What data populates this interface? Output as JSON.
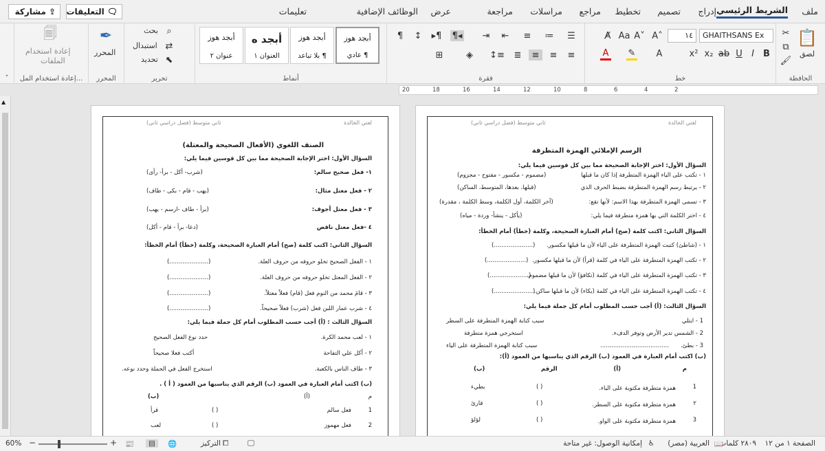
{
  "tabs": {
    "file": "ملف",
    "home": "الشريط الرئيسي",
    "insert": "إدراج",
    "design": "تصميم",
    "layout": "تخطيط",
    "references": "مراجع",
    "mailings": "مراسلات",
    "review": "مراجعة",
    "view": "عرض",
    "addins": "الوظائف الإضافية",
    "help": "تعليمات"
  },
  "topbar": {
    "comments": "التعليقات",
    "share": "مشاركة"
  },
  "clipboard": {
    "paste": "لصق",
    "label": "الحافظة"
  },
  "font": {
    "name": "GHAITHSANS Ex",
    "size": "١٤",
    "label": "خط"
  },
  "paragraph": {
    "label": "فقرة"
  },
  "styles": {
    "label": "أنماط",
    "items": [
      {
        "sample": "أبجد هوز",
        "name": "¶ عادي"
      },
      {
        "sample": "أبجد هوز",
        "name": "¶ بلا تباعد"
      },
      {
        "sample": "أبجد ه",
        "name": "العنوان ١"
      },
      {
        "sample": "أبجد هوز",
        "name": "عنوان ٢"
      }
    ]
  },
  "editing": {
    "find": "بحث",
    "replace": "استبدال",
    "select": "تحديد",
    "label": "تحرير"
  },
  "editor": {
    "title": "المحرر",
    "label": "المحرر"
  },
  "reuse": {
    "title": "إعادة استخدام",
    "title2": "الملفات",
    "label": "إعادة استخدام المل..."
  },
  "ruler": {
    "ticks": [
      "20",
      "18",
      "16",
      "14",
      "12",
      "10",
      "8",
      "6",
      "4",
      "2"
    ]
  },
  "doc": {
    "page_left": {
      "header_right": "لغتي الخالدة",
      "header_left": "ثاني متوسط (فصل دراسي ثاني)",
      "title": "الصنف اللغوي (الأفعال الصحيحة والمعتلة)",
      "q1": "السؤال الأول: اختر الإجابة الصحيحة مما بين كل قوسين فيما يلي:",
      "q1_items": [
        {
          "q": "١- فعل صحيح سالم:",
          "a": "(شرب- أكل - برأ- رأى)"
        },
        {
          "q": "٢ - فعل معتل مثال:",
          "a": "(يهب - قام - بكى - طاف)"
        },
        {
          "q": "٣ - فعل معتل أجوف:",
          "a": "(برأ - طاف -ارسم - يهب)"
        },
        {
          "q": "٤ -فعل معتل ناقص",
          "a": "(دعا- برأ - قام - أكل)"
        }
      ],
      "q2": "السؤال الثاني: اكتب كلمة (صح) أمام العبارة الصحيحة، وكلمة (خطأ) أمام الخطأ:",
      "q2_items": [
        "١ - الفعل الصحيح تخلو حروفه من حروف العلة.",
        "٢ - الفعل المعتل تخلو حروفه من حروف العلة.",
        "٣ - قامَ محمد من النوم فعل (قام) فعلاً معتلاً.",
        "٤ - شرب عمار اللبن فعل (شرب) فعلاً صحيحاً."
      ],
      "blank": "(.....................)",
      "q3": "السؤال الثالث : (أ) أجب حسب المطلوب أمام كل جملة فيما يلي:",
      "q3_items": [
        {
          "q": "١ - لعب محمد الكرة.",
          "a": "حدد نوع الفعل الصحيح"
        },
        {
          "q": "٢ - أكل علي التفاحة",
          "a": "أكتب فعلا صحيحاً"
        },
        {
          "q": "٣ - طاف الناس بالكعبة.",
          "a": "استخرج الفعل في الجملة وحدد نوعه."
        }
      ],
      "q3b": "(ب) اكتب أمام العبارة في العمود (ب) الرقم الذي يناسبها من العمود ( أ ) .",
      "col_m": "م",
      "col_a": "(أ)",
      "col_b": "(ب)",
      "q3b_rows": [
        {
          "n": "1",
          "a": "فعل سالم",
          "b": "قرأ"
        },
        {
          "n": "2",
          "a": "فعل مهموز",
          "b": "لعب"
        }
      ],
      "paren": "(          )"
    },
    "page_right": {
      "header_right": "لغتي الخالدة",
      "header_left": "ثاني متوسط (فصل دراسي ثاني)",
      "title": "الرسم الإملائي الهمزة المتطرفة",
      "q1": "السؤال الأول: اختر الإجابة الصحيحة مما بين كل قوسين فيما يلي:",
      "q1_items": [
        {
          "q": "١ - تكتب على الياء الهمزة المتطرفة إذا كان ما قبلها",
          "a": "(مضموم - مكسور - مفتوح - مجزوم)"
        },
        {
          "q": "٢ - يرتبط رسم الهمزة المتطرفة بضبط الحرف الذي",
          "a": "(قبلها، بعدها، المتوسط، الساكن)"
        },
        {
          "q": "٣ - تسمى الهمزة المتطرفة بهذا الاسم: لأنها تقع:",
          "a": "(آخر الكلمة، أول الكلمة، وسط الكلمة ، مقدرة)"
        },
        {
          "q": "٤ - اختر الكلمة التي بها همزة متطرفة فيما يلي:",
          "a": "(يأكل - ينشأ- وردة - مياه)"
        }
      ],
      "q2": "السؤال الثاني: اكتب كلمة (صح) أمام العبارة الصحيحة، وكلمة (خطأ) أمام الخطأ:",
      "q2_items": [
        "١ - (شاطئ) كتبت الهمزة المتطرفة على الياء لأن ما قبلها مكسور.",
        "٢ - تكتب الهمزة المتطرفة على الياء في كلمة (قرأ) لأن ما قبلها مكسور.",
        "٣ - تكتب الهمزة المتطرفة على الياء في كلمة (تكافؤ) لأن ما قبلها مضموم.",
        "٤ - تكتب الهمزة المتطرفة على الياء في كلمة (بكاء) لأن ما قبلها ساكن."
      ],
      "blank": "(.....................)",
      "q3": "السؤال الثالث: (أ) أجب حسب المطلوب أمام كل جملة فيما يلي:",
      "q3_items": [
        {
          "q": "1 - ابتلي",
          "a": "سبب كتابة الهمزة المتطرفة على السطر"
        },
        {
          "q": "2 - الشمس تدير الأرض وتوفر الدفء.",
          "a": "استخرجي همزة متطرفة"
        },
        {
          "q": "3 - بطئ.",
          "a": "سبب كتابة الهمزة المتطرفة على الياء"
        }
      ],
      "q3b": "(ب) اكتب أمام العبارة في العمود (ب) الرقم الذي يناسبها من العمود (أ):",
      "col_m": "م",
      "col_a": "(أ)",
      "col_b": "(ب)",
      "col_num": "الرقم",
      "q3b_rows": [
        {
          "n": "1",
          "a": "همزة متطرفة مكتوبة على الياء.",
          "b": "بطيء"
        },
        {
          "n": "٢",
          "a": "همزة متطرفة مكتوبة على السطر.",
          "b": "قارئ"
        },
        {
          "n": "3",
          "a": "همزة متطرفة مكتوبة على الواو.",
          "b": "لؤلؤ"
        }
      ],
      "paren": "(          )",
      "dots": "....................................."
    }
  },
  "status": {
    "page": "الصفحة ١ من ١٢",
    "words": "٢٨٠٩ كلمات",
    "lang": "العربية (مصر)",
    "access": "إمكانية الوصول: غير متاحة",
    "focus": "التركيز",
    "zoom": "60%"
  }
}
